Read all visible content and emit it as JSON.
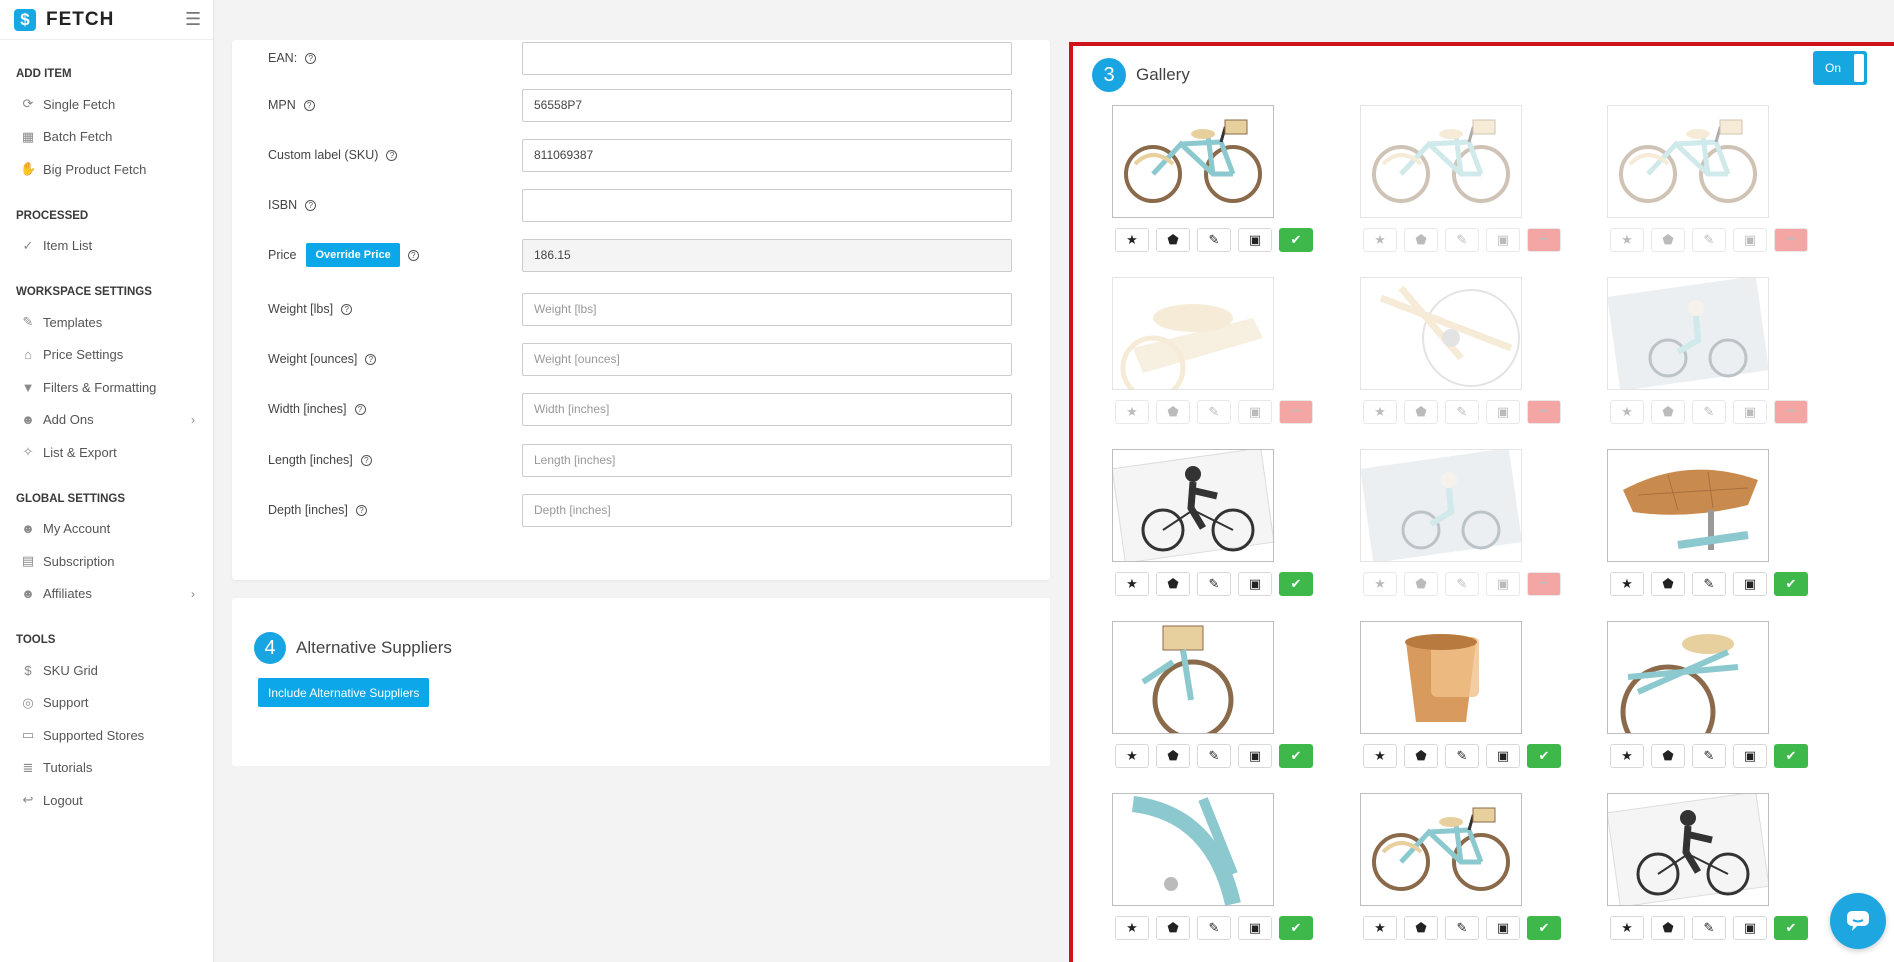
{
  "brand": {
    "name": "FETCH"
  },
  "sidebar": {
    "sections": [
      {
        "heading": "ADD ITEM",
        "items": [
          {
            "label": "Single Fetch",
            "icon": "single-fetch-icon"
          },
          {
            "label": "Batch Fetch",
            "icon": "batch-fetch-icon"
          },
          {
            "label": "Big Product Fetch",
            "icon": "hand-icon"
          }
        ]
      },
      {
        "heading": "PROCESSED",
        "items": [
          {
            "label": "Item List",
            "icon": "checklist-icon"
          }
        ]
      },
      {
        "heading": "WORKSPACE SETTINGS",
        "items": [
          {
            "label": "Templates",
            "icon": "brush-icon"
          },
          {
            "label": "Price Settings",
            "icon": "tags-icon"
          },
          {
            "label": "Filters & Formatting",
            "icon": "filter-icon"
          },
          {
            "label": "Add Ons",
            "icon": "user-plus-icon",
            "expandable": true
          },
          {
            "label": "List & Export",
            "icon": "magic-icon"
          }
        ]
      },
      {
        "heading": "GLOBAL SETTINGS",
        "items": [
          {
            "label": "My Account",
            "icon": "user-icon"
          },
          {
            "label": "Subscription",
            "icon": "receipt-icon"
          },
          {
            "label": "Affiliates",
            "icon": "affiliate-icon",
            "expandable": true
          }
        ]
      },
      {
        "heading": "TOOLS",
        "items": [
          {
            "label": "SKU Grid",
            "icon": "dollar-icon"
          },
          {
            "label": "Support",
            "icon": "lifebuoy-icon"
          },
          {
            "label": "Supported Stores",
            "icon": "store-icon"
          },
          {
            "label": "Tutorials",
            "icon": "books-icon"
          },
          {
            "label": "Logout",
            "icon": "logout-icon"
          }
        ]
      }
    ]
  },
  "form": {
    "ean": {
      "label": "EAN:",
      "value": "",
      "placeholder": ""
    },
    "mpn": {
      "label": "MPN",
      "value": "56558P7",
      "placeholder": ""
    },
    "sku": {
      "label": "Custom label (SKU)",
      "value": "811069387",
      "placeholder": ""
    },
    "isbn": {
      "label": "ISBN",
      "value": "",
      "placeholder": ""
    },
    "price": {
      "label": "Price",
      "button": "Override Price",
      "value": "186.15"
    },
    "weight_lbs": {
      "label": "Weight [lbs]",
      "value": "",
      "placeholder": "Weight [lbs]"
    },
    "weight_oz": {
      "label": "Weight [ounces]",
      "value": "",
      "placeholder": "Weight [ounces]"
    },
    "width": {
      "label": "Width [inches]",
      "value": "",
      "placeholder": "Width [inches]"
    },
    "length": {
      "label": "Length [inches]",
      "value": "",
      "placeholder": "Length [inches]"
    },
    "depth": {
      "label": "Depth [inches]",
      "value": "",
      "placeholder": "Depth [inches]"
    }
  },
  "alt_suppliers": {
    "step": "4",
    "title": "Alternative Suppliers",
    "button": "Include Alternative Suppliers"
  },
  "gallery": {
    "step": "3",
    "title": "Gallery",
    "toggle_label": "On",
    "images": [
      {
        "subject": "full-bike-side",
        "included": true
      },
      {
        "subject": "full-bike-side",
        "included": false
      },
      {
        "subject": "full-bike-angle",
        "included": false
      },
      {
        "subject": "seat-rack",
        "included": false
      },
      {
        "subject": "frame-pedal",
        "included": false
      },
      {
        "subject": "rider-photo",
        "included": false
      },
      {
        "subject": "rider-diagram",
        "included": true
      },
      {
        "subject": "rider-photo",
        "included": false
      },
      {
        "subject": "seat-closeup",
        "included": true
      },
      {
        "subject": "front-basket-wheel",
        "included": true
      },
      {
        "subject": "cup-holder",
        "included": true
      },
      {
        "subject": "rear-rack",
        "included": true
      },
      {
        "subject": "fender-bell",
        "included": true
      },
      {
        "subject": "full-bike-side",
        "included": true
      },
      {
        "subject": "rider-diagram",
        "included": true
      }
    ]
  },
  "colors": {
    "accent": "#19a5e2",
    "ok": "#3eb84a",
    "remove": "#f4a6a4",
    "highlight_border": "#d0131b"
  }
}
